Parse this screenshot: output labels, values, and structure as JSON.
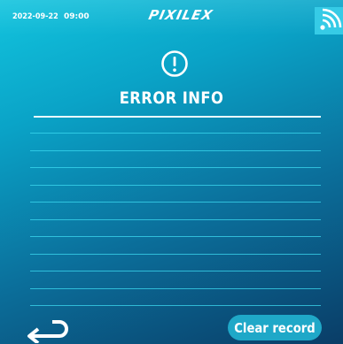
{
  "status_bar": {
    "date": "2022-09-22",
    "time": "09:00",
    "brand": "PIXILEX",
    "wifi_icon": "wifi-icon"
  },
  "main": {
    "alert_icon": "alert-circle-icon",
    "title": "ERROR INFO",
    "records": [],
    "empty_row_count": 11
  },
  "footer": {
    "back_icon": "return-arrow-icon",
    "clear_label": "Clear record"
  },
  "colors": {
    "accent": "#12c4de",
    "background_bottom": "#0a3d67",
    "button": "#1fa8c8",
    "record_line": "#3cdaf0"
  }
}
